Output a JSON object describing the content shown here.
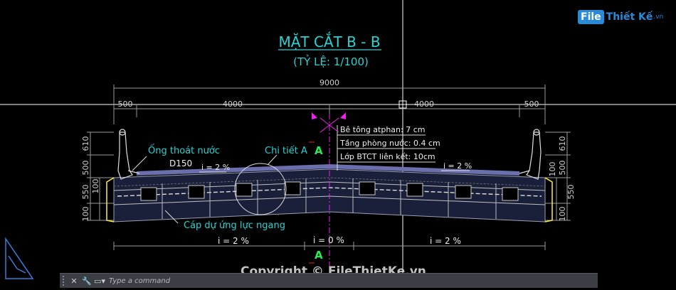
{
  "title": "MẶT CẮT B - B",
  "scale": "(TỶ LỆ: 1/100)",
  "dimensions": {
    "total": "9000",
    "left_cantilever": "500",
    "left_half": "4000",
    "right_half": "4000",
    "right_cantilever": "500",
    "left_vertical": [
      "610",
      "500",
      "550",
      "100"
    ],
    "left_vertical_inner": "100",
    "right_vertical": [
      "610",
      "500",
      "550",
      "100"
    ],
    "right_vertical_inner": "100"
  },
  "labels": {
    "drain_pipe": "Ống thoát nước",
    "drain_size": "D150",
    "detail": "Chi tiết A",
    "layer1": "Bê tông atphan: 7 cm",
    "layer2": "Tầng phòng nước: 0.4 cm",
    "layer3": "Lớp BTCT liên kết: 10cm",
    "cable": "Cáp dự ứng lực ngang",
    "section_mark": "A",
    "slope_top_left": "i = 2 %",
    "slope_top_right": "i = 2 %",
    "slope_bottom_left": "i = 2 %",
    "slope_bottom_mid": "i = 0 %",
    "slope_bottom_right": "i = 2 %"
  },
  "command_bar": {
    "close": "✕",
    "wrench": "🔧",
    "placeholder": "Type a command"
  },
  "watermark": "Copyright © FileThietKe.vn",
  "logo": {
    "box": "File",
    "text": "Thiết Kế",
    "domain": ".vn"
  },
  "colors": {
    "background": "#000000",
    "cyan": "#27d4d4",
    "green": "#22ee55",
    "magenta": "#ee22ee",
    "white": "#ffffff"
  }
}
